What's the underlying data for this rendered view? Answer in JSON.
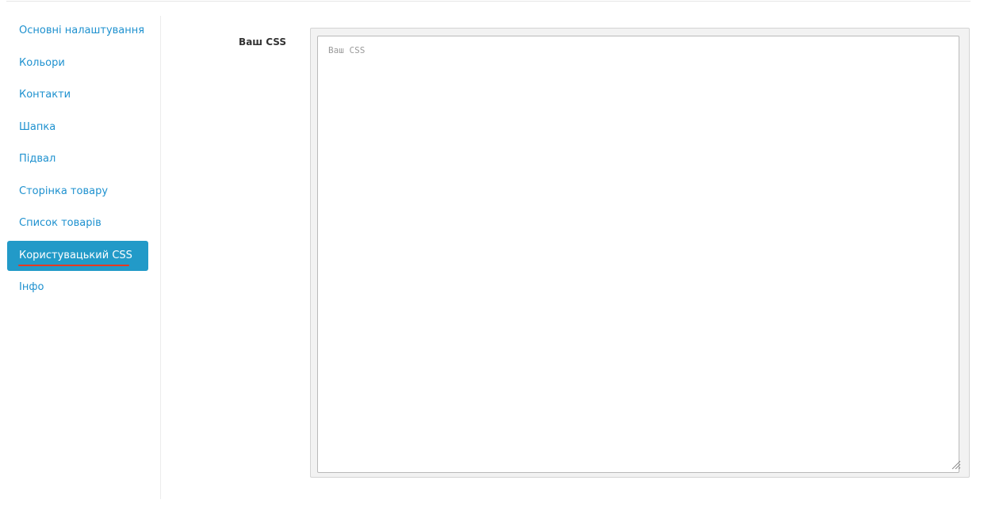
{
  "sidebar": {
    "items": [
      {
        "label": "Основні налаштування"
      },
      {
        "label": "Кольори"
      },
      {
        "label": "Контакти"
      },
      {
        "label": "Шапка"
      },
      {
        "label": "Підвал"
      },
      {
        "label": "Сторінка товару"
      },
      {
        "label": "Список товарів"
      },
      {
        "label": "Користувацький CSS",
        "active": true
      },
      {
        "label": "Інфо"
      }
    ]
  },
  "form": {
    "css_label": "Ваш CSS",
    "css_value": "",
    "css_placeholder": "Ваш CSS"
  },
  "colors": {
    "link": "#1e91cf",
    "active_bg": "#229ac8",
    "active_text": "#ffffff",
    "annotation_underline": "#e8391f"
  }
}
